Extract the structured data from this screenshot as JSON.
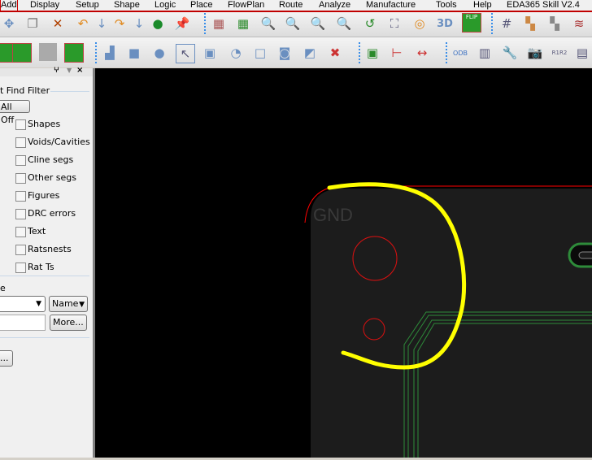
{
  "menu": [
    "Add",
    "Display",
    "Setup",
    "Shape",
    "Logic",
    "Place",
    "FlowPlan",
    "Route",
    "Analyze",
    "Manufacture",
    "Tools",
    "Help",
    "EDA365 Skill V2.4"
  ],
  "panel": {
    "title": "t Find Filter",
    "all_off": "All Off",
    "items": [
      "Shapes",
      "Voids/Cavities",
      "Cline segs",
      "Other segs",
      "Figures",
      "DRC errors",
      "Text",
      "Ratsnests",
      "Rat Ts"
    ],
    "section2": "e",
    "name_select": "Name",
    "more": "More...",
    "dots_button": "..."
  },
  "canvas": {
    "net_label": "GND",
    "colors": {
      "outline": "#ff0000",
      "annotation": "#ffff00",
      "trace": "#2e8b3a",
      "board": "#1c1c1c"
    }
  }
}
